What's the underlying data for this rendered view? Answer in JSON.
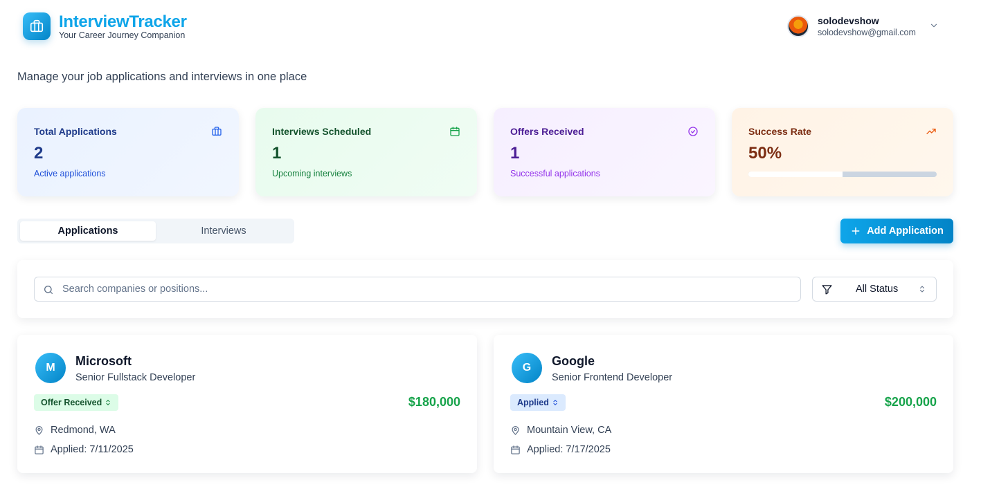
{
  "brand": {
    "title": "InterviewTracker",
    "subtitle": "Your Career Journey Companion",
    "icon": "briefcase-icon"
  },
  "user": {
    "name": "solodevshow",
    "email": "solodevshow@gmail.com"
  },
  "tagline": "Manage your job applications and interviews in one place",
  "stats": [
    {
      "label": "Total Applications",
      "value": "2",
      "note": "Active applications",
      "icon": "briefcase-icon"
    },
    {
      "label": "Interviews Scheduled",
      "value": "1",
      "note": "Upcoming interviews",
      "icon": "calendar-icon"
    },
    {
      "label": "Offers Received",
      "value": "1",
      "note": "Successful applications",
      "icon": "check-circle-icon"
    },
    {
      "label": "Success Rate",
      "value": "50%",
      "progress": 0.5,
      "icon": "trending-up-icon"
    }
  ],
  "tabs": {
    "applications": "Applications",
    "interviews": "Interviews",
    "active": "Applications"
  },
  "add_button": {
    "label": "Add Application"
  },
  "search": {
    "placeholder": "Search companies or positions...",
    "value": ""
  },
  "status_filter": {
    "selected": "All Status"
  },
  "applications": [
    {
      "initial": "M",
      "company": "Microsoft",
      "position": "Senior Fullstack Developer",
      "status": "Offer Received",
      "salary": "$180,000",
      "location": "Redmond, WA",
      "applied": "Applied: 7/11/2025"
    },
    {
      "initial": "G",
      "company": "Google",
      "position": "Senior Frontend Developer",
      "status": "Applied",
      "salary": "$200,000",
      "location": "Mountain View, CA",
      "applied": "Applied: 7/17/2025"
    }
  ],
  "colors": {
    "brand": "#0ea5e9",
    "salary": "#16a34a",
    "offer_badge": "#dcfce7",
    "applied_badge": "#dbeafe"
  }
}
